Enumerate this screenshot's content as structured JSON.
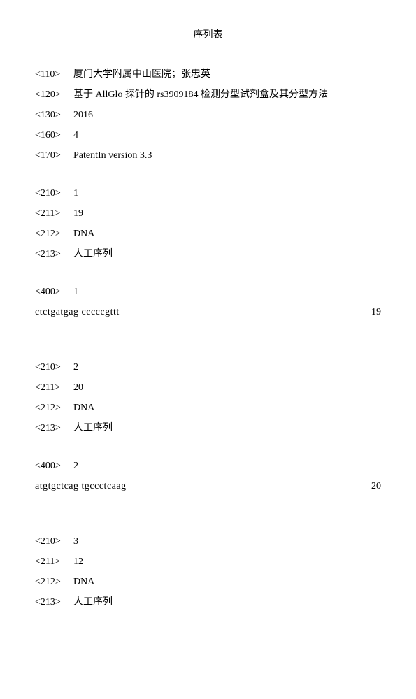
{
  "title": "序列表",
  "header": {
    "tag110": "<110>",
    "val110": "厦门大学附属中山医院；张忠英",
    "tag120": "<120>",
    "val120": "基于 AllGlo 探针的 rs3909184 检测分型试剂盒及其分型方法",
    "tag130": "<130>",
    "val130": "2016",
    "tag160": "<160>",
    "val160": "4",
    "tag170": "<170>",
    "val170": "PatentIn version 3.3"
  },
  "seq1": {
    "tag210": "<210>",
    "val210": "1",
    "tag211": "<211>",
    "val211": "19",
    "tag212": "<212>",
    "val212": "DNA",
    "tag213": "<213>",
    "val213": "人工序列",
    "tag400": "<400>",
    "val400": "1",
    "sequence": "ctctgatgag cccccgttt",
    "length": "19"
  },
  "seq2": {
    "tag210": "<210>",
    "val210": "2",
    "tag211": "<211>",
    "val211": "20",
    "tag212": "<212>",
    "val212": "DNA",
    "tag213": "<213>",
    "val213": "人工序列",
    "tag400": "<400>",
    "val400": "2",
    "sequence": "atgtgctcag tgccctcaag",
    "length": "20"
  },
  "seq3": {
    "tag210": "<210>",
    "val210": "3",
    "tag211": "<211>",
    "val211": "12",
    "tag212": "<212>",
    "val212": "DNA",
    "tag213": "<213>",
    "val213": "人工序列"
  }
}
